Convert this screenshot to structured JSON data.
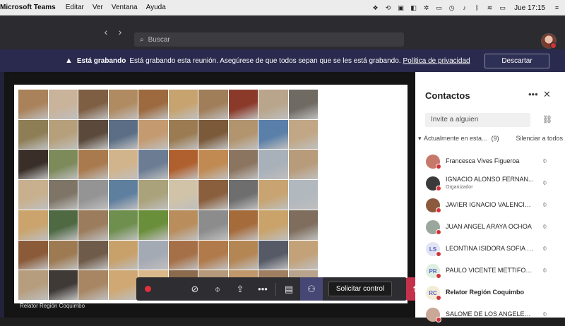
{
  "menubar": {
    "app": "Microsoft Teams",
    "items": [
      "Editar",
      "Ver",
      "Ventana",
      "Ayuda"
    ],
    "clock": "Jue 17:15"
  },
  "search": {
    "placeholder": "Buscar"
  },
  "banner": {
    "bold": "Está grabando",
    "text": "Está grabando esta reunión. Asegúrese de que todos sepan que se les está grabando.",
    "link": "Política de privacidad",
    "dismiss": "Descartar"
  },
  "stage": {
    "presenter": "Relator Región Coquimbo",
    "tile_colors": [
      "#a9825b",
      "#c9b39a",
      "#7e5f44",
      "#b08b62",
      "#9c6a3e",
      "#c7a36f",
      "#a07e5a",
      "#8b3a2a",
      "#b9a58c",
      "#6f6a62",
      "#8d7e55",
      "#b6a07b",
      "#5b4a3b",
      "#5b6e85",
      "#c49a70",
      "#9a7b52",
      "#7b5a3a",
      "#b2946e",
      "#5a7fa8",
      "#c1a785",
      "#3a2f28",
      "#7d8a5a",
      "#a97a4d",
      "#d2b48c",
      "#6b7c93",
      "#b0602e",
      "#c08a52",
      "#8c7560",
      "#a8b0b9",
      "#b89b7a",
      "#c8b08e",
      "#7e7566",
      "#949494",
      "#5f7f9f",
      "#a9a27a",
      "#d0c3a8",
      "#8a5f3d",
      "#6e6e6e",
      "#c7a471",
      "#b1b8be",
      "#caa46c",
      "#4f6a43",
      "#9b7c5c",
      "#6f8f4f",
      "#6a8f3a",
      "#b98d5c",
      "#8c8c8c",
      "#a66b3b",
      "#c9a36a",
      "#7f6e5d",
      "#8b5a38",
      "#9d7a52",
      "#6f5b49",
      "#c8a06a",
      "#a4aab4",
      "#a56f47",
      "#b07a4a",
      "#b48654",
      "#555a66",
      "#c3a27a",
      "#b59d7d",
      "#3f3a36",
      "#a98663",
      "#cfa873",
      "#d9b98a",
      "#8a6b4e",
      "#b49a7b",
      "#c1986b",
      "#9f7f61",
      "#b8a48d"
    ]
  },
  "controls": {
    "timer": "",
    "request_control": "Solicitar control"
  },
  "panel": {
    "title": "Contactos",
    "invite_placeholder": "Invite a alguien",
    "section": "Actualmente en esta...",
    "count": "(9)",
    "mute_all": "Silenciar a todos",
    "participants": [
      {
        "initials": "",
        "avatar": "#c6796a",
        "name": "Francesca Vives Figueroa",
        "role": ""
      },
      {
        "initials": "",
        "avatar": "#3a3a3a",
        "name": "IGNACIO ALONSO FERNAN...",
        "role": "Organizador"
      },
      {
        "initials": "",
        "avatar": "#8b5a3c",
        "name": "JAVIER IGNACIO VALENCIA I...",
        "role": ""
      },
      {
        "initials": "",
        "avatar": "#9aa79c",
        "name": "JUAN ANGEL ARAYA OCHOA",
        "role": ""
      },
      {
        "initials": "LS",
        "avatar": "#e1e4f3",
        "name": "LEONTINA ISIDORA SOFIA L...",
        "role": ""
      },
      {
        "initials": "PR",
        "avatar": "#dcefe0",
        "name": "PAULO VICENTE METTIFOG...",
        "role": ""
      },
      {
        "initials": "RC",
        "avatar": "#f3ecd6",
        "name": "Relator Región Coquimbo",
        "role": ""
      },
      {
        "initials": "",
        "avatar": "#c9a897",
        "name": "SALOME DE LOS ANGELES V...",
        "role": ""
      }
    ]
  }
}
